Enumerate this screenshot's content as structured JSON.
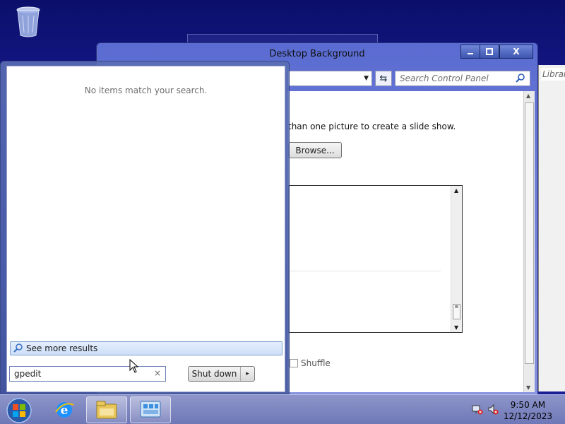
{
  "desktop": {
    "recycle_bin_icon": "recycle-bin-icon"
  },
  "control_panel": {
    "title": "Desktop Background",
    "window_buttons": {
      "minimize": "",
      "maximize": "",
      "close": "X"
    },
    "search_placeholder": "Search Control Panel",
    "instruction_text": "than one picture to create a slide show.",
    "browse_label": "Browse...",
    "shuffle_label": "Shuffle"
  },
  "library_window": {
    "search_placeholder": "Librar"
  },
  "start_menu": {
    "no_items_text": "No items match your search.",
    "see_more_label": "See more results",
    "search_value": "gpedit",
    "clear_glyph": "×",
    "shutdown_label": "Shut down",
    "shutdown_arrow": "▸"
  },
  "taskbar": {
    "time": "9:50 AM",
    "date": "12/12/2023",
    "pinned": [
      "internet-explorer-icon",
      "file-explorer-icon",
      "control-panel-icon"
    ]
  }
}
